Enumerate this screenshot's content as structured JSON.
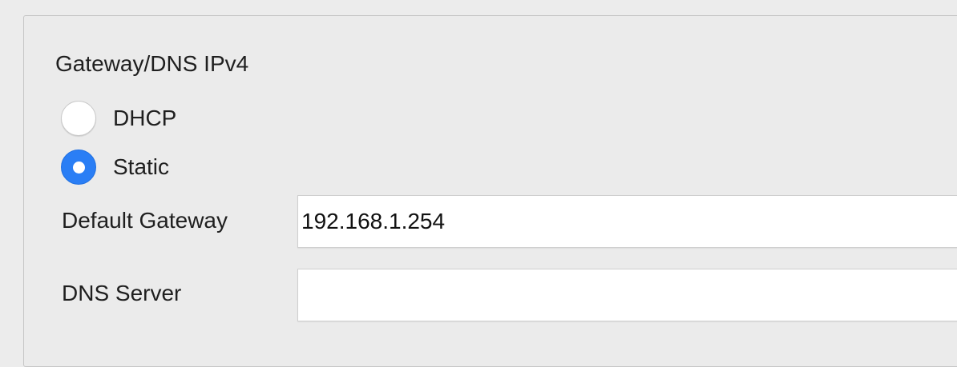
{
  "section": {
    "title": "Gateway/DNS IPv4"
  },
  "mode": {
    "options": [
      {
        "label": "DHCP",
        "selected": false
      },
      {
        "label": "Static",
        "selected": true
      }
    ]
  },
  "fields": {
    "default_gateway": {
      "label": "Default Gateway",
      "value": "192.168.1.254",
      "placeholder": ""
    },
    "dns_server": {
      "label": "DNS Server",
      "value": "",
      "placeholder": ""
    }
  },
  "colors": {
    "accent": "#2a7ef5",
    "background": "#ececec",
    "field_background": "#ffffff"
  }
}
